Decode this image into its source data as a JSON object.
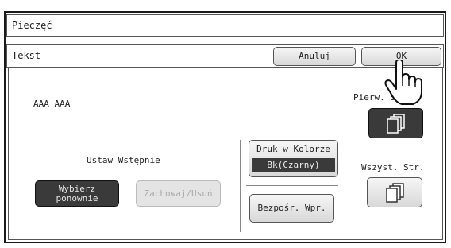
{
  "window": {
    "title": "Pieczęć"
  },
  "toolbar": {
    "section_label": "Tekst",
    "cancel_label": "Anuluj",
    "ok_label": "OK"
  },
  "text_field": {
    "value": "AAA AAA"
  },
  "preset": {
    "label": "Ustaw Wstępnie",
    "reselect_label": "Wybierz ponownie",
    "save_delete_label": "Zachowaj/Usuń"
  },
  "color_print": {
    "label": "Druk w Kolorze",
    "value": "Bk(Czarny)"
  },
  "direct_entry": {
    "label": "Bezpośr. Wpr."
  },
  "pages": {
    "first_page_label": "Pierw. S",
    "all_pages_label": "Wszyst. Str."
  }
}
